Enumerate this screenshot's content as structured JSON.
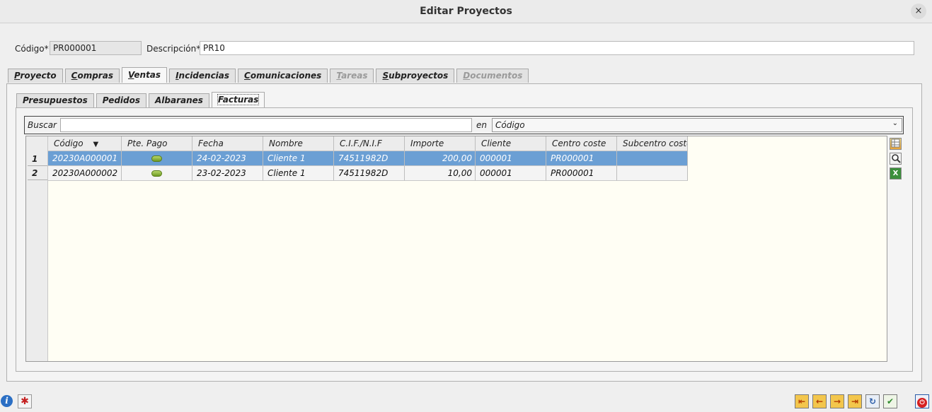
{
  "window": {
    "title": "Editar Proyectos",
    "close_icon": "×"
  },
  "header": {
    "codigo_label": "Código*",
    "codigo_value": "PR000001",
    "descripcion_label": "Descripción*",
    "descripcion_value": "PR10"
  },
  "tabs": [
    {
      "acc": "P",
      "rest": "royecto",
      "state": "normal"
    },
    {
      "acc": "C",
      "rest": "ompras",
      "state": "normal"
    },
    {
      "acc": "V",
      "rest": "entas",
      "state": "active"
    },
    {
      "acc": "I",
      "rest": "ncidencias",
      "state": "normal"
    },
    {
      "acc": "C",
      "rest": "omunicaciones",
      "state": "normal"
    },
    {
      "acc": "T",
      "rest": "areas",
      "state": "disabled"
    },
    {
      "acc": "S",
      "rest": "ubproyectos",
      "state": "normal"
    },
    {
      "acc": "D",
      "rest": "ocumentos",
      "state": "disabled"
    }
  ],
  "subtabs": [
    "Presupuestos",
    "Pedidos",
    "Albaranes",
    "Facturas"
  ],
  "search": {
    "label": "Buscar",
    "value": "",
    "en_label": "en",
    "field_selected": "Código"
  },
  "table": {
    "columns": [
      "Código",
      "Pte. Pago",
      "Fecha",
      "Nombre",
      "C.I.F./N.I.F",
      "Importe",
      "Cliente",
      "Centro coste",
      "Subcentro coste"
    ],
    "rows": [
      {
        "n": "1",
        "codigo": "20230A000001",
        "pte_pago": "green",
        "fecha": "24-02-2023",
        "nombre": "Cliente 1",
        "cif": "74511982D",
        "importe": "200,00",
        "cliente": "000001",
        "centro": "PR000001",
        "subcentro": ""
      },
      {
        "n": "2",
        "codigo": "20230A000002",
        "pte_pago": "green",
        "fecha": "23-02-2023",
        "nombre": "Cliente 1",
        "cif": "74511982D",
        "importe": "10,00",
        "cliente": "000001",
        "centro": "PR000001",
        "subcentro": ""
      }
    ]
  },
  "side_icons": [
    "table-settings-icon",
    "magnifier-icon",
    "excel-icon"
  ],
  "footer": {
    "left_icons": [
      "info-icon",
      "bug-icon"
    ],
    "nav_icons": [
      "first-icon",
      "prev-icon",
      "next-icon",
      "last-icon",
      "refresh-icon",
      "accept-icon"
    ],
    "power_icon": "power-icon"
  }
}
